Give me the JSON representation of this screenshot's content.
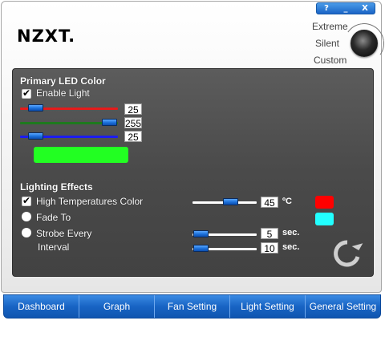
{
  "window": {
    "controls": {
      "help": "?",
      "minimize": "_",
      "close": "X"
    }
  },
  "brand": {
    "logo": "NZXT."
  },
  "modes": {
    "extreme": "Extreme",
    "silent": "Silent",
    "custom": "Custom"
  },
  "primary_led": {
    "title": "Primary LED Color",
    "enable_label": "Enable Light",
    "enabled": true,
    "red": "25",
    "green": "255",
    "blue": "25",
    "preview_color": "#22ff22"
  },
  "lighting_effects": {
    "title": "Lighting Effects",
    "high_temp": {
      "label": "High Temperatures Color",
      "checked": true,
      "value": "45",
      "unit": "ºC",
      "color": "#ff0000"
    },
    "fade": {
      "label": "Fade To",
      "color": "#22ffff"
    },
    "strobe": {
      "label": "Strobe Every",
      "value": "5",
      "unit": "sec."
    },
    "interval": {
      "label": "Interval",
      "value": "10",
      "unit": "sec."
    }
  },
  "tabs": [
    "Dashboard",
    "Graph",
    "Fan Setting",
    "Light Setting",
    "General Setting"
  ]
}
